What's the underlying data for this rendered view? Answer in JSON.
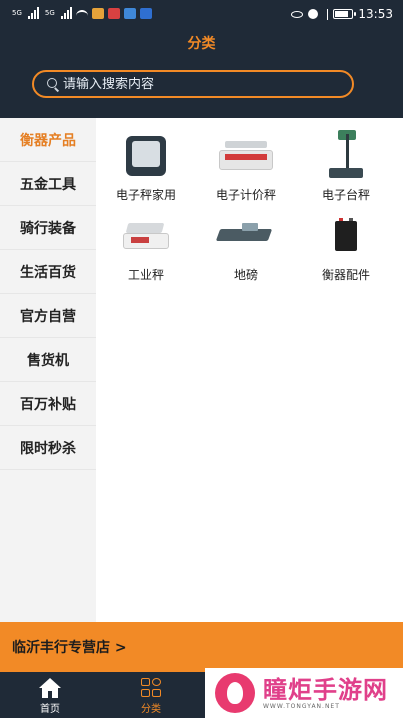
{
  "statusbar": {
    "time": "13:53",
    "left_badges": [
      "5G",
      "5G"
    ]
  },
  "header": {
    "title": "分类"
  },
  "search": {
    "placeholder": "请输入搜索内容"
  },
  "sidebar": {
    "items": [
      {
        "label": "衡器产品",
        "active": true
      },
      {
        "label": "五金工具",
        "active": false
      },
      {
        "label": "骑行装备",
        "active": false
      },
      {
        "label": "生活百货",
        "active": false
      },
      {
        "label": "官方自营",
        "active": false
      },
      {
        "label": "售货机",
        "active": false
      },
      {
        "label": "百万补贴",
        "active": false
      },
      {
        "label": "限时秒杀",
        "active": false
      }
    ]
  },
  "products": [
    {
      "label": "电子秤家用",
      "icon": "home-scale-icon"
    },
    {
      "label": "电子计价秤",
      "icon": "price-scale-icon"
    },
    {
      "label": "电子台秤",
      "icon": "platform-scale-icon"
    },
    {
      "label": "工业秤",
      "icon": "industrial-scale-icon"
    },
    {
      "label": "地磅",
      "icon": "floor-scale-icon"
    },
    {
      "label": "衡器配件",
      "icon": "battery-icon"
    }
  ],
  "store": {
    "label": "临沂丰行专营店 >"
  },
  "bottom_nav": {
    "home_label": "首页",
    "category_label": "分类"
  },
  "watermark": {
    "title": "瞳炬手游网",
    "subtitle": "WWW.TONGYAN.NET"
  },
  "colors": {
    "header_bg": "#1f2a37",
    "accent": "#f28a26",
    "sidebar_bg": "#f3f3f3"
  }
}
